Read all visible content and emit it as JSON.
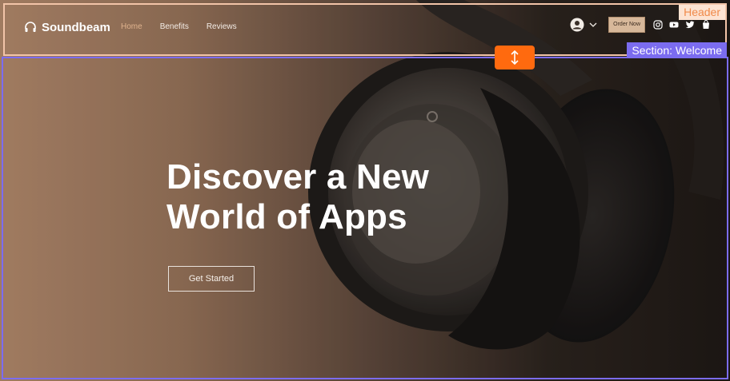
{
  "header": {
    "tag": "Header",
    "brand": "Soundbeam",
    "nav": [
      {
        "label": "Home",
        "active": true
      },
      {
        "label": "Benefits",
        "active": false
      },
      {
        "label": "Reviews",
        "active": false
      }
    ],
    "order_label": "Order Now",
    "icons": [
      "account-icon",
      "chevron-down-icon",
      "instagram-icon",
      "youtube-icon",
      "twitter-icon",
      "cart-icon"
    ]
  },
  "section": {
    "tag": "Section: Welcome",
    "resize_icon": "resize-vertical-icon"
  },
  "hero": {
    "title": "Discover a New World of Apps",
    "cta_label": "Get Started"
  },
  "colors": {
    "header_outline": "#f2c4a8",
    "section_outline": "#7b6cf0",
    "handle": "#ff6a0f",
    "active_nav": "#e0b38e"
  }
}
